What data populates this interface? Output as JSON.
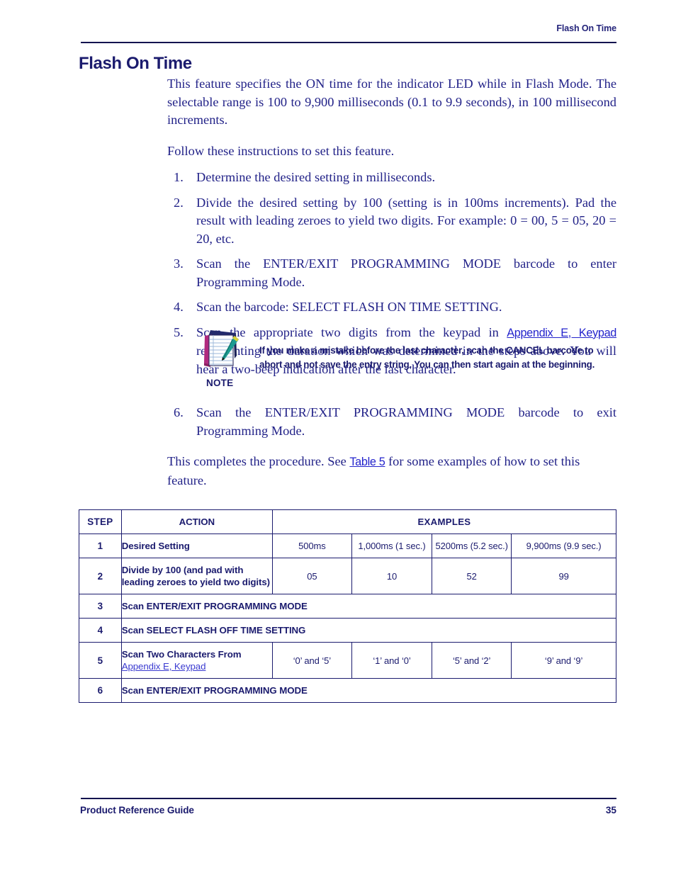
{
  "header": {
    "running_title": "Flash On Time"
  },
  "title": "Flash On Time",
  "intro": {
    "paragraph1": "This feature specifies the ON time for the indicator LED while in Flash Mode. The selectable range is 100 to 9,900 milliseconds (0.1 to 9.9 seconds), in 100 millisecond increments.",
    "paragraph2": "Follow these instructions to set this feature."
  },
  "steps": [
    {
      "num": "1.",
      "text": "Determine the desired setting in milliseconds."
    },
    {
      "num": "2.",
      "text": "Divide the desired setting by 100 (setting is in 100ms increments). Pad the result with leading zeroes to yield two digits. For example: 0 = 00, 5 = 05, 20 = 20, etc."
    },
    {
      "num": "3.",
      "text": "Scan the ENTER/EXIT PROGRAMMING MODE barcode to enter Programming Mode."
    },
    {
      "num": "4.",
      "text": "Scan the barcode: SELECT FLASH ON TIME SETTING."
    }
  ],
  "step5": {
    "num": "5.",
    "text_before": "Scan the appropriate two digits from the keypad in ",
    "link": "Appendix E, Keypad",
    "text_after": " representing the duration which was determined in the steps above. You will hear a two-beep indication after the last character."
  },
  "note": {
    "icon": "notepad-pen-icon",
    "label": "NOTE",
    "text": "If you make a mistake before the last character, scan the CANCEL barcode to abort and not save the entry string. You can then start again at the beginning."
  },
  "step6": {
    "num": "6.",
    "text": "Scan the ENTER/EXIT PROGRAMMING MODE barcode to exit Programming Mode."
  },
  "closing": {
    "text_before": "This completes the procedure. See ",
    "link": "Table 5",
    "text_after": " for some examples of how to set this feature."
  },
  "table": {
    "headers": {
      "step": "STEP",
      "action": "ACTION",
      "examples": "EXAMPLES"
    },
    "rows": [
      {
        "step": "1",
        "action": "Desired Setting",
        "action_link": null,
        "examples": [
          "500ms",
          "1,000ms (1 sec.)",
          "5200ms (5.2 sec.)",
          "9,900ms (9.9 sec.)"
        ]
      },
      {
        "step": "2",
        "action": "Divide by 100 (and pad with leading zeroes to yield two digits)",
        "action_link": null,
        "examples": [
          "05",
          "10",
          "52",
          "99"
        ]
      },
      {
        "step": "3",
        "action": "Scan ENTER/EXIT PROGRAMMING MODE",
        "action_link": null,
        "examples": null
      },
      {
        "step": "4",
        "action": "Scan SELECT FLASH OFF TIME SETTING",
        "action_link": null,
        "examples": null
      },
      {
        "step": "5",
        "action": "Scan Two Characters From",
        "action_link": "Appendix E, Keypad",
        "examples": [
          "‘0’ and ‘5’",
          "‘1’ and ‘0’",
          "‘5’ and ‘2’",
          "‘9’ and ‘9’"
        ]
      },
      {
        "step": "6",
        "action": "Scan ENTER/EXIT PROGRAMMING MODE",
        "action_link": null,
        "examples": null
      }
    ]
  },
  "footer": {
    "left": "Product Reference Guide",
    "page_number": "35"
  },
  "colors": {
    "navy": "#1b1b6e",
    "body_blue": "#222288",
    "link_blue": "#2424cc",
    "rule": "#13134f"
  }
}
